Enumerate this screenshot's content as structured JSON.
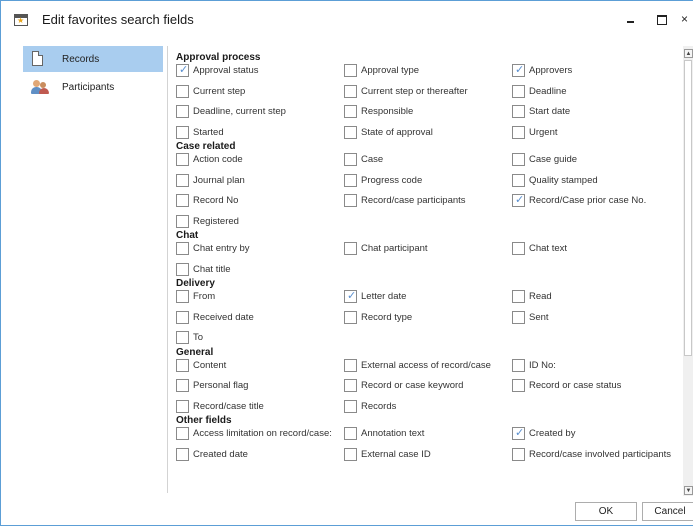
{
  "window": {
    "title": "Edit favorites search fields",
    "close_glyph": "×"
  },
  "sidebar": {
    "items": [
      {
        "label": "Records",
        "icon": "document-icon",
        "selected": true
      },
      {
        "label": "Participants",
        "icon": "people-icon",
        "selected": false
      }
    ]
  },
  "groups": [
    {
      "title": "Approval process",
      "fields": [
        {
          "label": "Approval status",
          "checked": true
        },
        {
          "label": "Approval type",
          "checked": false
        },
        {
          "label": "Approvers",
          "checked": true
        },
        {
          "label": "Current step",
          "checked": false
        },
        {
          "label": "Current step or thereafter",
          "checked": false
        },
        {
          "label": "Deadline",
          "checked": false
        },
        {
          "label": "Deadline, current step",
          "checked": false
        },
        {
          "label": "Responsible",
          "checked": false
        },
        {
          "label": "Start date",
          "checked": false
        },
        {
          "label": "Started",
          "checked": false
        },
        {
          "label": "State of approval",
          "checked": false
        },
        {
          "label": "Urgent",
          "checked": false
        }
      ]
    },
    {
      "title": "Case related",
      "fields": [
        {
          "label": "Action code",
          "checked": false
        },
        {
          "label": "Case",
          "checked": false
        },
        {
          "label": "Case guide",
          "checked": false
        },
        {
          "label": "Journal plan",
          "checked": false
        },
        {
          "label": "Progress code",
          "checked": false
        },
        {
          "label": "Quality stamped",
          "checked": false
        },
        {
          "label": "Record No",
          "checked": false
        },
        {
          "label": "Record/case participants",
          "checked": false
        },
        {
          "label": "Record/Case prior case No.",
          "checked": true
        },
        {
          "label": "Registered",
          "checked": false
        }
      ]
    },
    {
      "title": "Chat",
      "fields": [
        {
          "label": "Chat entry by",
          "checked": false
        },
        {
          "label": "Chat participant",
          "checked": false
        },
        {
          "label": "Chat text",
          "checked": false
        },
        {
          "label": "Chat title",
          "checked": false
        }
      ]
    },
    {
      "title": "Delivery",
      "fields": [
        {
          "label": "From",
          "checked": false
        },
        {
          "label": "Letter date",
          "checked": true
        },
        {
          "label": "Read",
          "checked": false
        },
        {
          "label": "Received date",
          "checked": false
        },
        {
          "label": "Record type",
          "checked": false
        },
        {
          "label": "Sent",
          "checked": false
        },
        {
          "label": "To",
          "checked": false
        }
      ]
    },
    {
      "title": "General",
      "fields": [
        {
          "label": "Content",
          "checked": false
        },
        {
          "label": "External access of record/case",
          "checked": false
        },
        {
          "label": "ID No:",
          "checked": false
        },
        {
          "label": "Personal flag",
          "checked": false
        },
        {
          "label": "Record or case keyword",
          "checked": false
        },
        {
          "label": "Record or case status",
          "checked": false
        },
        {
          "label": "Record/case title",
          "checked": false
        },
        {
          "label": "Records",
          "checked": false
        }
      ]
    },
    {
      "title": "Other fields",
      "fields": [
        {
          "label": "Access limitation on record/case:",
          "checked": false
        },
        {
          "label": "Annotation text",
          "checked": false
        },
        {
          "label": "Created by",
          "checked": true
        },
        {
          "label": "Created date",
          "checked": false
        },
        {
          "label": "External case ID",
          "checked": false
        },
        {
          "label": "Record/case involved participants",
          "checked": false
        }
      ]
    }
  ],
  "buttons": {
    "ok": "OK",
    "cancel": "Cancel"
  },
  "colors": {
    "selection": "#a9cdef",
    "check": "#5a8fcf",
    "border": "#5c9ed6"
  }
}
